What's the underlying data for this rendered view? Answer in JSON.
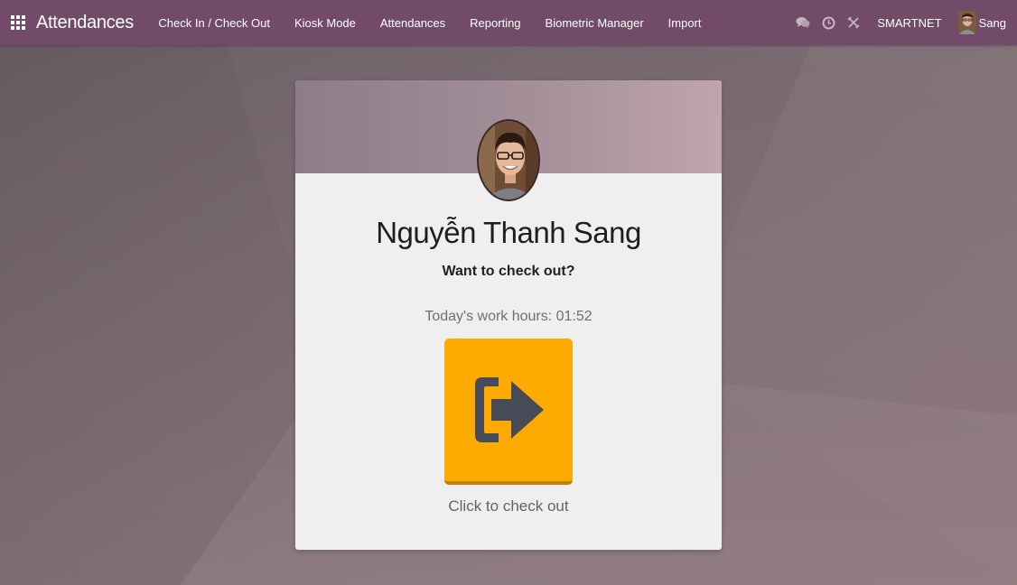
{
  "navbar": {
    "app_title": "Attendances",
    "menu": [
      {
        "label": "Check In / Check Out"
      },
      {
        "label": "Kiosk Mode"
      },
      {
        "label": "Attendances"
      },
      {
        "label": "Reporting"
      },
      {
        "label": "Biometric Manager"
      },
      {
        "label": "Import"
      }
    ],
    "icons": [
      "chat-icon",
      "activity-clock-icon",
      "debug-icon"
    ],
    "company": "SMARTNET",
    "user_name": "Sang"
  },
  "card": {
    "employee_name": "Nguyễn Thanh Sang",
    "question": "Want to check out?",
    "work_hours": "Today's work hours: 01:52",
    "button_icon": "sign-out-icon",
    "button_caption": "Click to check out"
  },
  "colors": {
    "navbar": "#714b67",
    "button": "#fdab00",
    "icon": "#474b57"
  }
}
